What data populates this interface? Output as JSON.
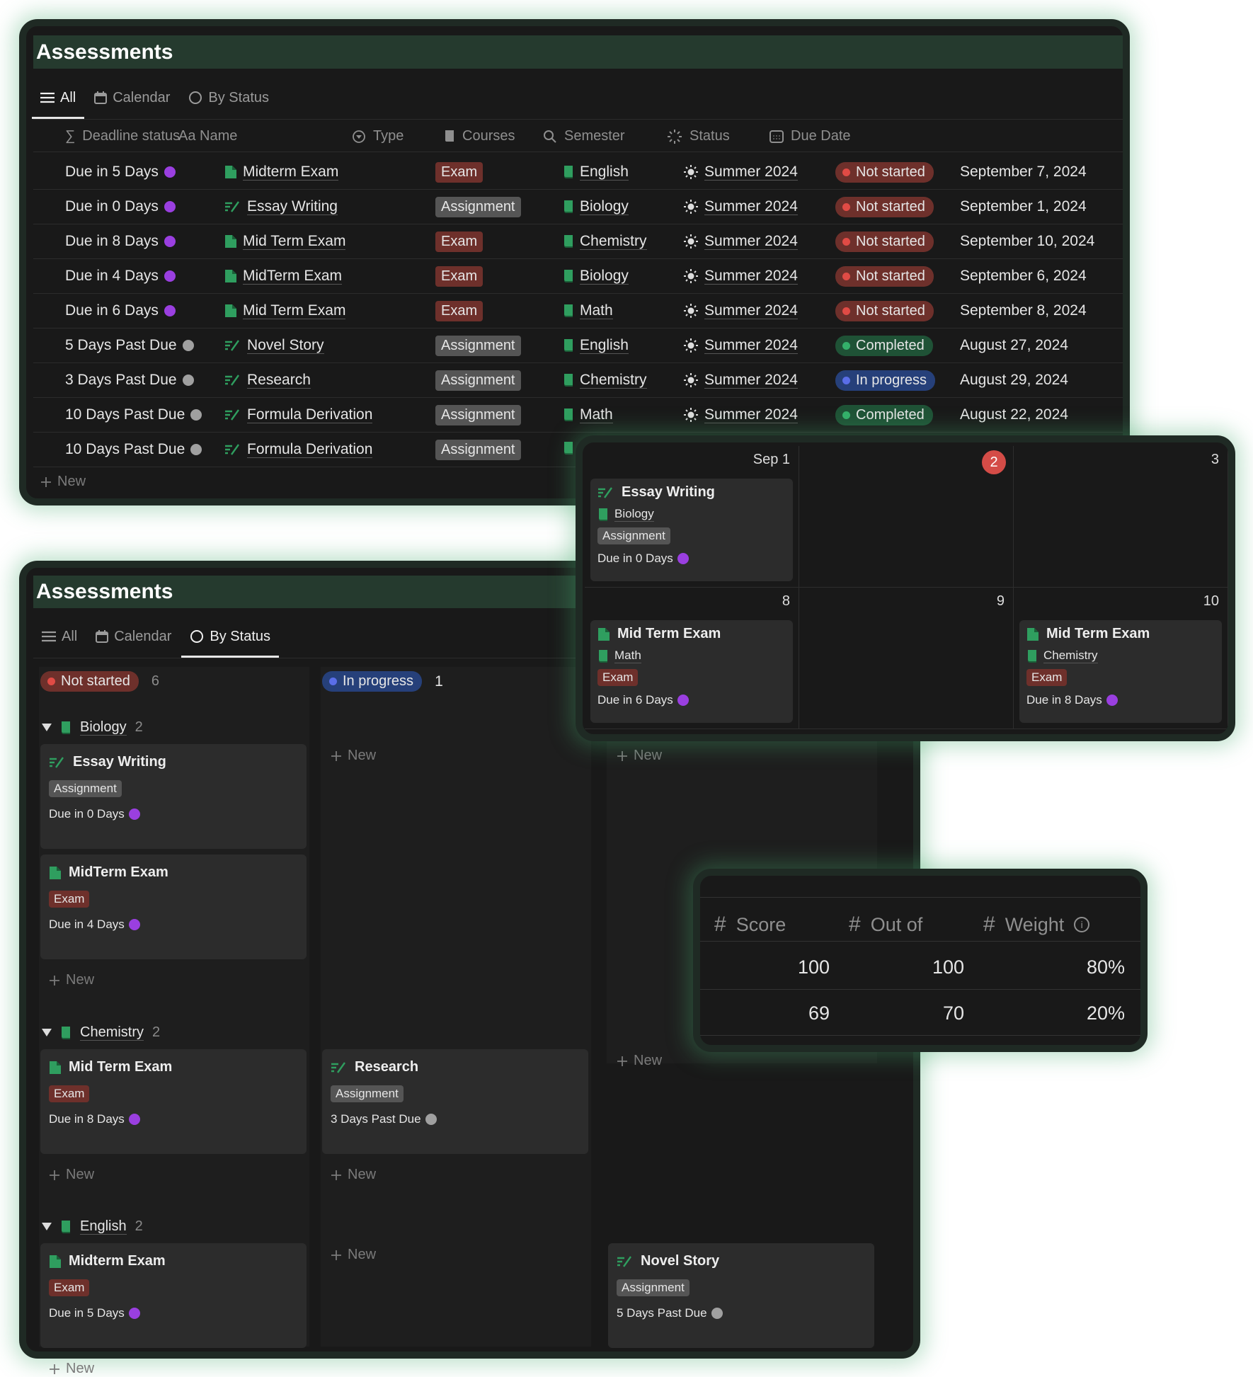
{
  "colors": {
    "accent": "#253a2e",
    "exam": "#6e302b",
    "assignment": "#555555",
    "not_started": "#6e302b",
    "completed": "#1f5236",
    "in_progress": "#26407a",
    "purple_dot": "#9a3fe0",
    "grey_dot": "#a0a0a0",
    "book": "#2f9e5f"
  },
  "table_view": {
    "title": "Assessments",
    "tabs": [
      {
        "label": "All",
        "icon": "list-icon",
        "active": true
      },
      {
        "label": "Calendar",
        "icon": "calendar-icon"
      },
      {
        "label": "By Status",
        "icon": "circle-icon"
      }
    ],
    "columns": [
      {
        "label": "Deadline status",
        "icon": "sigma-icon"
      },
      {
        "label": "Aa Name",
        "icon": ""
      },
      {
        "label": "Type",
        "icon": "select-icon"
      },
      {
        "label": "Courses",
        "icon": "book-icon"
      },
      {
        "label": "Semester",
        "icon": "search-icon"
      },
      {
        "label": "Status",
        "icon": "loader-icon"
      },
      {
        "label": "Due Date",
        "icon": "calendar-icon"
      }
    ],
    "rows": [
      {
        "deadline": "Due in 5 Days",
        "dot": "purple",
        "name": "Midterm Exam",
        "icon": "doc",
        "type": "Exam",
        "course": "English",
        "semester": "Summer 2024",
        "status": "Not started",
        "due": "September 7, 2024"
      },
      {
        "deadline": "Due in 0 Days",
        "dot": "purple",
        "name": "Essay Writing",
        "icon": "pen",
        "type": "Assignment",
        "course": "Biology",
        "semester": "Summer 2024",
        "status": "Not started",
        "due": "September 1, 2024"
      },
      {
        "deadline": "Due in 8 Days",
        "dot": "purple",
        "name": "Mid Term Exam",
        "icon": "doc",
        "type": "Exam",
        "course": "Chemistry",
        "semester": "Summer 2024",
        "status": "Not started",
        "due": "September 10, 2024"
      },
      {
        "deadline": "Due in 4 Days",
        "dot": "purple",
        "name": "MidTerm Exam",
        "icon": "doc",
        "type": "Exam",
        "course": "Biology",
        "semester": "Summer 2024",
        "status": "Not started",
        "due": "September 6, 2024"
      },
      {
        "deadline": "Due in 6 Days",
        "dot": "purple",
        "name": "Mid Term Exam",
        "icon": "doc",
        "type": "Exam",
        "course": "Math",
        "semester": "Summer 2024",
        "status": "Not started",
        "due": "September 8, 2024"
      },
      {
        "deadline": "5 Days Past Due",
        "dot": "grey",
        "name": "Novel Story",
        "icon": "pen",
        "type": "Assignment",
        "course": "English",
        "semester": "Summer 2024",
        "status": "Completed",
        "due": "August 27, 2024"
      },
      {
        "deadline": "3 Days Past Due",
        "dot": "grey",
        "name": "Research",
        "icon": "pen",
        "type": "Assignment",
        "course": "Chemistry",
        "semester": "Summer 2024",
        "status": "In progress",
        "due": "August 29, 2024"
      },
      {
        "deadline": "10 Days Past Due",
        "dot": "grey",
        "name": "Formula Derivation",
        "icon": "pen",
        "type": "Assignment",
        "course": "Math",
        "semester": "Summer 2024",
        "status": "Completed",
        "due": "August 22, 2024"
      },
      {
        "deadline": "10 Days Past Due",
        "dot": "grey",
        "name": "Formula Derivation",
        "icon": "pen",
        "type": "Assignment",
        "course": "",
        "semester": "",
        "status": "",
        "due": ""
      }
    ],
    "new_label": "New"
  },
  "board_view": {
    "title": "Assessments",
    "tabs": [
      {
        "label": "All",
        "icon": "list-icon"
      },
      {
        "label": "Calendar",
        "icon": "calendar-icon"
      },
      {
        "label": "By Status",
        "icon": "circle-icon",
        "active": true
      }
    ],
    "statuses": [
      {
        "label": "Not started",
        "count": "6"
      },
      {
        "label": "In progress",
        "count": "1"
      }
    ],
    "groups": [
      {
        "name": "Biology",
        "count": "2",
        "cols": [
          [
            {
              "name": "Essay Writing",
              "icon": "pen",
              "type": "Assignment",
              "deadline": "Due in 0 Days",
              "dot": "purple"
            },
            {
              "name": "MidTerm Exam",
              "icon": "doc",
              "type": "Exam",
              "deadline": "Due in 4 Days",
              "dot": "purple"
            }
          ],
          [],
          []
        ]
      },
      {
        "name": "Chemistry",
        "count": "2",
        "cols": [
          [
            {
              "name": "Mid Term Exam",
              "icon": "doc",
              "type": "Exam",
              "deadline": "Due in 8 Days",
              "dot": "purple"
            }
          ],
          [
            {
              "name": "Research",
              "icon": "pen",
              "type": "Assignment",
              "deadline": "3 Days Past Due",
              "dot": "grey"
            }
          ],
          []
        ]
      },
      {
        "name": "English",
        "count": "2",
        "cols": [
          [
            {
              "name": "Midterm Exam",
              "icon": "doc",
              "type": "Exam",
              "deadline": "Due in 5 Days",
              "dot": "purple"
            }
          ],
          [],
          [
            {
              "name": "Novel Story",
              "icon": "pen",
              "type": "Assignment",
              "deadline": "5 Days Past Due",
              "dot": "grey"
            }
          ]
        ]
      }
    ],
    "new_label": "New"
  },
  "calendar_view": {
    "today": "2",
    "cells": [
      {
        "day": "Sep 1",
        "card": {
          "name": "Essay Writing",
          "icon": "pen",
          "course": "Biology",
          "type": "Assignment",
          "deadline": "Due in 0 Days"
        }
      },
      {
        "day": "2",
        "today": true
      },
      {
        "day": "3"
      },
      {
        "day": "8",
        "card": {
          "name": "Mid Term Exam",
          "icon": "doc",
          "course": "Math",
          "type": "Exam",
          "deadline": "Due in 6 Days"
        }
      },
      {
        "day": "9"
      },
      {
        "day": "10",
        "card": {
          "name": "Mid Term Exam",
          "icon": "doc",
          "course": "Chemistry",
          "type": "Exam",
          "deadline": "Due in 8 Days"
        }
      }
    ]
  },
  "score_view": {
    "columns": [
      {
        "label": "Score",
        "icon": "hash-icon"
      },
      {
        "label": "Out of",
        "icon": "hash-icon"
      },
      {
        "label": "Weight",
        "icon": "hash-icon",
        "info": true
      }
    ],
    "rows": [
      [
        "100",
        "100",
        "80%"
      ],
      [
        "69",
        "70",
        "20%"
      ]
    ]
  }
}
